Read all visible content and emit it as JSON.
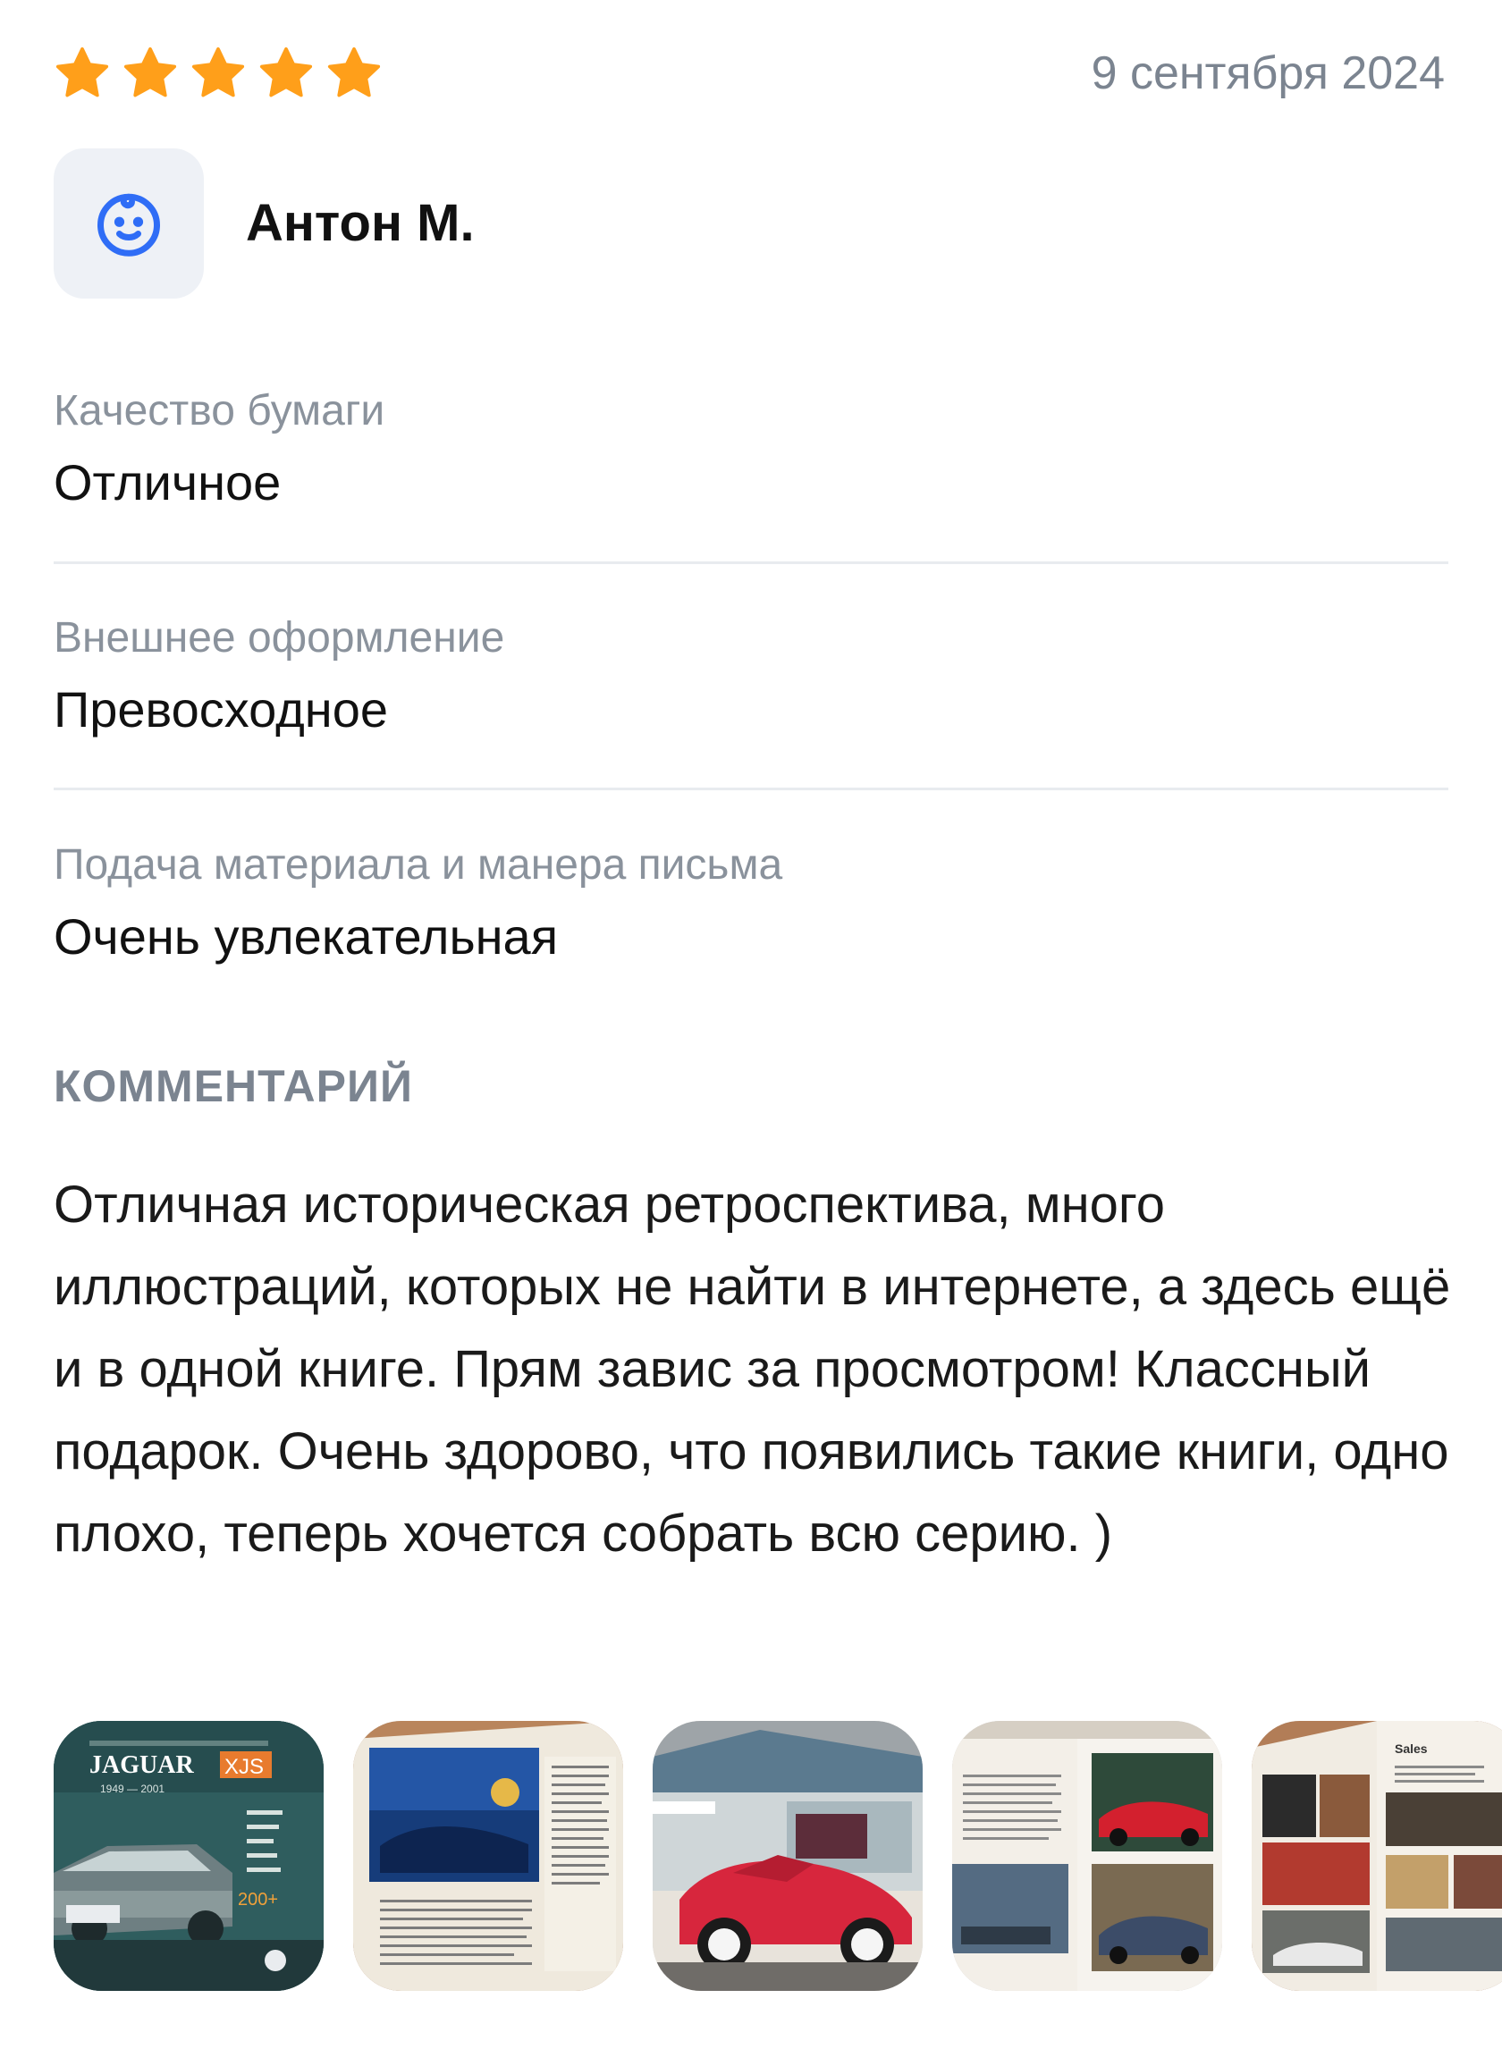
{
  "review": {
    "rating": 5,
    "rating_max": 5,
    "date": "9 сентября 2024",
    "author": "Антон М.",
    "avatar_icon": "smiling-baby-face-icon",
    "attributes": [
      {
        "label": "Качество бумаги",
        "value": "Отличное"
      },
      {
        "label": "Внешнее оформление",
        "value": "Превосходное"
      },
      {
        "label": "Подача материала и манера письма",
        "value": "Очень увлекательная"
      }
    ],
    "comment_title": "КОММЕНТАРИЙ",
    "comment": "Отличная историческая ретроспектива, много иллюстраций, которых не найти в интернете, а здесь ещё и в одной книге. Прям завис за просмотром! Классный подарок. Очень здорово, что появились такие книги, одно плохо, теперь хочется собрать всю серию. )"
  },
  "photos": {
    "cover_brand": "JAGUAR",
    "cover_model": "XJS",
    "cover_years": "1949 — 2001",
    "cover_badge": "200+",
    "page_heading": "Sales"
  },
  "colors": {
    "star": "#FF9F1A",
    "accent": "#2F6DF6",
    "muted_text": "#8A929C",
    "divider": "#E8EBEF"
  }
}
